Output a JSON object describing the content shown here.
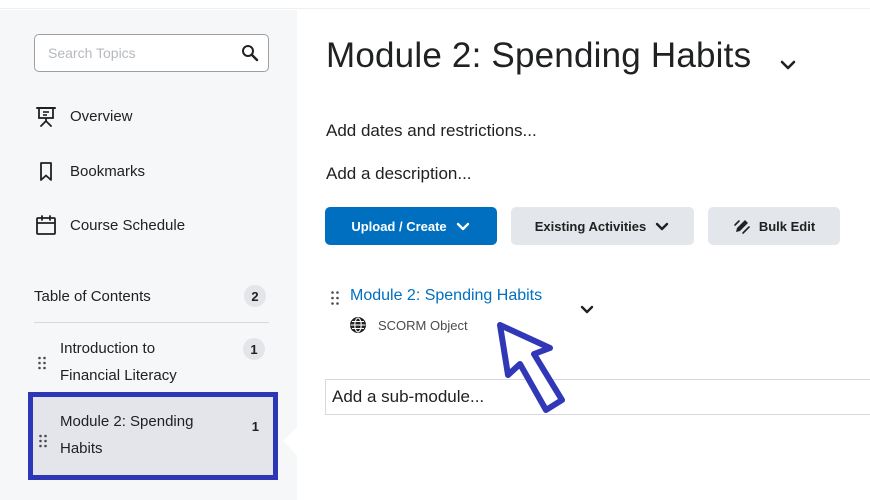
{
  "sidebar": {
    "search": {
      "placeholder": "Search Topics",
      "value": ""
    },
    "nav": [
      {
        "label": "Overview",
        "icon": "presentation-icon"
      },
      {
        "label": "Bookmarks",
        "icon": "bookmark-icon"
      },
      {
        "label": "Course Schedule",
        "icon": "calendar-icon"
      }
    ],
    "toc": {
      "title": "Table of Contents",
      "count": "2",
      "items": [
        {
          "line1": "Introduction to",
          "line2": "Financial Literacy",
          "count": "1",
          "selected": false
        },
        {
          "line1": "Module 2: Spending",
          "line2": "Habits",
          "count": "1",
          "selected": true
        }
      ]
    }
  },
  "main": {
    "title": "Module 2: Spending Habits",
    "add_dates": "Add dates and restrictions...",
    "add_description": "Add a description...",
    "toolbar": {
      "upload_create": "Upload / Create",
      "existing_activities": "Existing Activities",
      "bulk_edit": "Bulk Edit"
    },
    "activity": {
      "title": "Module 2: Spending Habits",
      "type": "SCORM Object"
    },
    "submodule": {
      "placeholder": "Add a sub-module...",
      "value": ""
    }
  },
  "colors": {
    "primary": "#006fbf",
    "highlight_box": "#2e36b8",
    "annotation_arrow": "#3138b8",
    "sidebar_bg": "#f6f7f8"
  }
}
